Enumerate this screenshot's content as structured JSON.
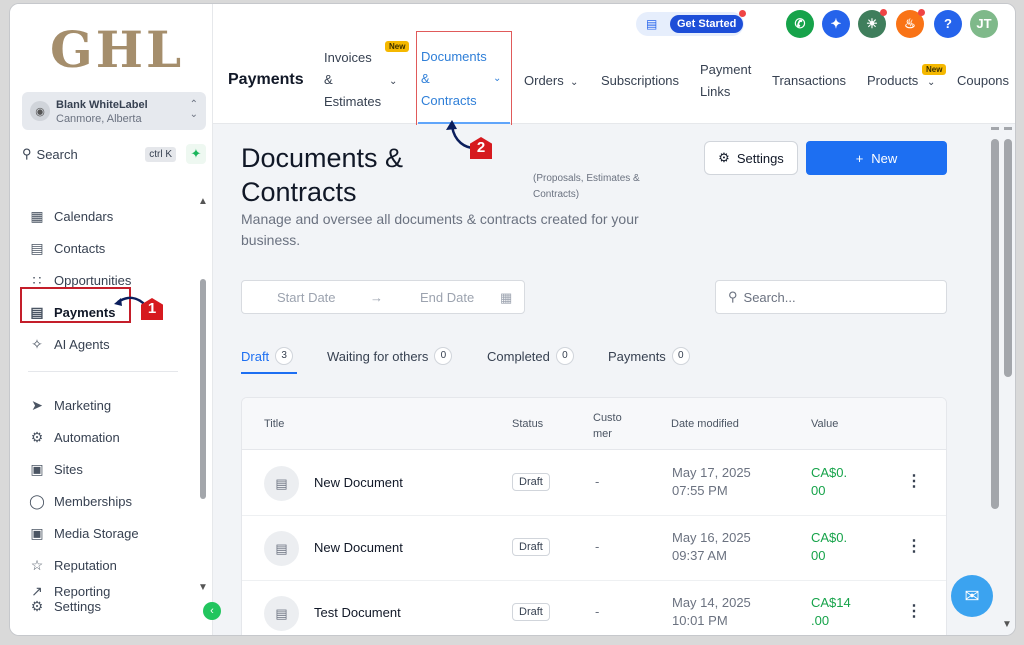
{
  "logo": "GHL",
  "account": {
    "name": "Blank WhiteLabel",
    "location": "Canmore, Alberta"
  },
  "search": {
    "label": "Search",
    "shortcut": "ctrl K"
  },
  "nav": {
    "calendars": "Calendars",
    "contacts": "Contacts",
    "opportunities": "Opportunities",
    "payments": "Payments",
    "ai_agents": "AI Agents",
    "marketing": "Marketing",
    "automation": "Automation",
    "sites": "Sites",
    "memberships": "Memberships",
    "media_storage": "Media Storage",
    "reputation": "Reputation",
    "reporting": "Reporting",
    "settings": "Settings"
  },
  "annotations": {
    "step1": "1",
    "step2": "2"
  },
  "header": {
    "get_started": "Get Started",
    "avatar": "JT",
    "help": "?",
    "page_title": "Payments",
    "tabs": {
      "invoices_l1": "Invoices",
      "invoices_l2": "&",
      "invoices_l3": "Estimates",
      "documents_l1": "Documents",
      "documents_l2": "&",
      "documents_l3": "Contracts",
      "orders": "Orders",
      "subscriptions": "Subscriptions",
      "payment_links_l1": "Payment",
      "payment_links_l2": "Links",
      "transactions": "Transactions",
      "products": "Products",
      "coupons": "Coupons"
    },
    "new_badge": "New"
  },
  "main": {
    "title_l1": "Documents &",
    "title_l2": "Contracts",
    "note_l1": "(Proposals, Estimates &",
    "note_l2": "Contracts)",
    "desc_l1": "Manage and oversee all documents & contracts created for your",
    "desc_l2": "business.",
    "settings_button": "Settings",
    "new_button": "New",
    "start_date": "Start Date",
    "end_date": "End Date",
    "search_placeholder": "Search...",
    "filters": {
      "draft": "Draft",
      "draft_count": "3",
      "waiting": "Waiting for others",
      "waiting_count": "0",
      "completed": "Completed",
      "completed_count": "0",
      "payments": "Payments",
      "payments_count": "0"
    },
    "table": {
      "headers": {
        "title": "Title",
        "status": "Status",
        "customer_l1": "Custo",
        "customer_l2": "mer",
        "date": "Date modified",
        "value": "Value"
      },
      "rows": [
        {
          "title": "New Document",
          "status": "Draft",
          "customer": "-",
          "date_l1": "May 17, 2025",
          "date_l2": "07:55 PM",
          "value_l1": "CA$0.",
          "value_l2": "00"
        },
        {
          "title": "New Document",
          "status": "Draft",
          "customer": "-",
          "date_l1": "May 16, 2025",
          "date_l2": "09:37 AM",
          "value_l1": "CA$0.",
          "value_l2": "00"
        },
        {
          "title": "Test Document",
          "status": "Draft",
          "customer": "-",
          "date_l1": "May 14, 2025",
          "date_l2": "10:01 PM",
          "value_l1": "CA$14",
          "value_l2": ".00"
        }
      ]
    }
  }
}
